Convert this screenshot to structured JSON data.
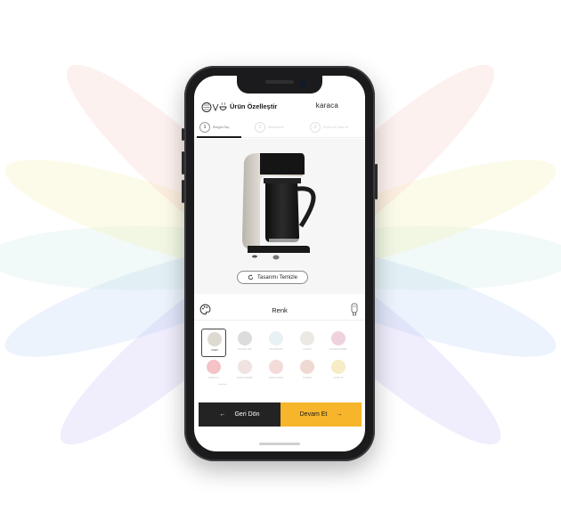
{
  "header": {
    "title": "Ürün Özelleştir",
    "brand": "karaca"
  },
  "stepper": {
    "steps": [
      {
        "number": "1",
        "label": "Rengini Seç"
      },
      {
        "number": "2",
        "label": "Aksesuarlar"
      },
      {
        "number": "3",
        "label": "Kontrol ve Satın Al"
      }
    ]
  },
  "product": {
    "reset_label": "Tasarımı Temizle"
  },
  "color_section": {
    "title": "Renk",
    "swatches": [
      {
        "name": "KREM",
        "color": "#dedad2"
      },
      {
        "name": "PASTEL GRİ",
        "color": "#dcdcdc"
      },
      {
        "name": "BUZ MAVİSİ",
        "color": "#e8f1f4"
      },
      {
        "name": "FİLDİŞİ",
        "color": "#ece9e4"
      },
      {
        "name": "PUDRA PEMBE",
        "color": "#efd2de"
      },
      {
        "name": "MERCAN",
        "color": "#f4c3c7"
      },
      {
        "name": "NUDE PEMBE",
        "color": "#f0e3e1"
      },
      {
        "name": "ROSE GOLD",
        "color": "#f3dcd8"
      },
      {
        "name": "SOMON",
        "color": "#f0d8d3"
      },
      {
        "name": "VANİLYA",
        "color": "#f6ecc5"
      }
    ],
    "selected_index": 0
  },
  "footer": {
    "back_label": "Geri Dön",
    "next_label": "Devam Et"
  },
  "colors": {
    "accent": "#f7b52b",
    "dark": "#232323"
  }
}
